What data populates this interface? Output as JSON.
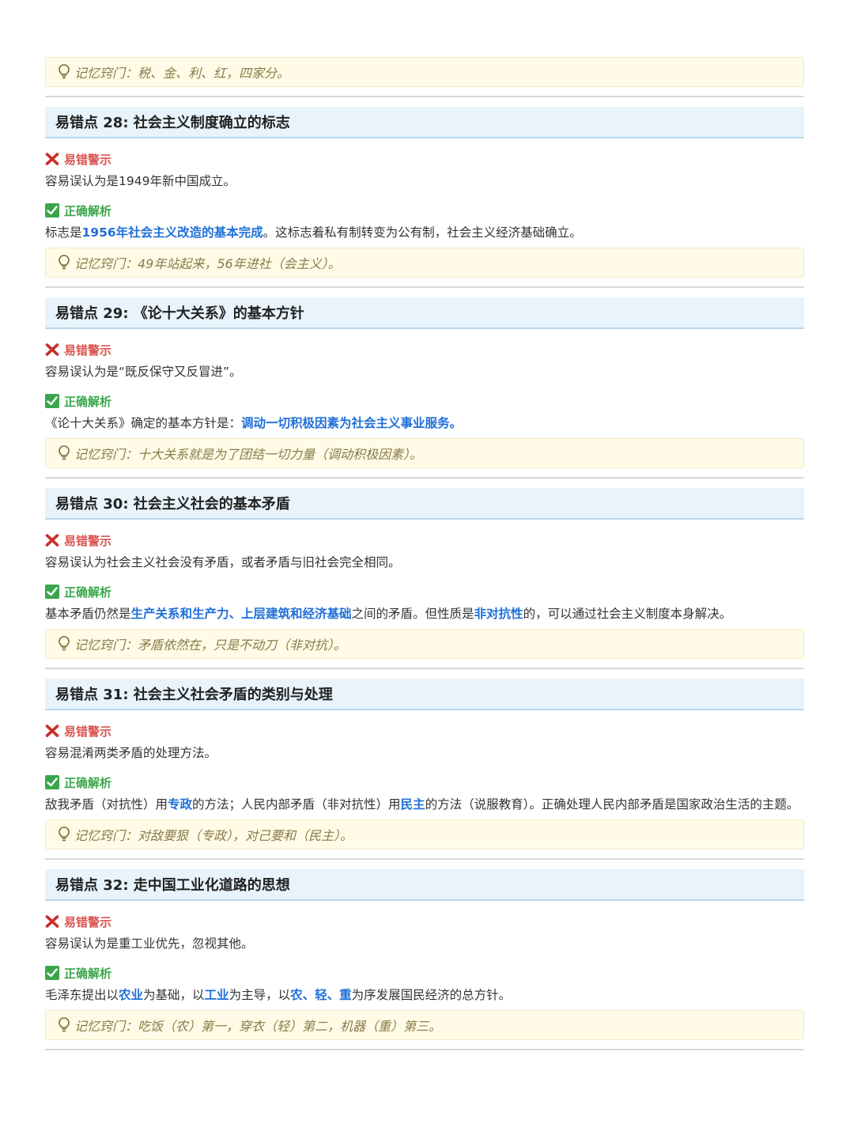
{
  "tips": {
    "t27": "记忆窍门：税、金、利、红，四家分。",
    "t28": "记忆窍门：49年站起来，56年进社（会主义）。",
    "t29": "记忆窍门：十大关系就是为了团结一切力量（调动积极因素）。",
    "t30": "记忆窍门：矛盾依然在，只是不动刀（非对抗）。",
    "t31": "记忆窍门：对敌要狠（专政），对己要和（民主）。",
    "t32": "记忆窍门：吃饭（农）第一，穿衣（轻）第二，机器（重）第三。"
  },
  "labels": {
    "wrong": "易错警示",
    "right": "正确解析"
  },
  "sections": [
    {
      "title": "易错点 28: 社会主义制度确立的标志",
      "wrong": "容易误认为是1949年新中国成立。",
      "right": [
        "标志是",
        "1956年社会主义改造的基本完成",
        "。这标志着私有制转变为公有制，社会主义经济基础确立。"
      ]
    },
    {
      "title": "易错点 29: 《论十大关系》的基本方针",
      "wrong": "容易误认为是“既反保守又反冒进”。",
      "right": [
        "《论十大关系》确定的基本方针是：",
        "调动一切积极因素为社会主义事业服务。"
      ]
    },
    {
      "title": "易错点 30: 社会主义社会的基本矛盾",
      "wrong": "容易误认为社会主义社会没有矛盾，或者矛盾与旧社会完全相同。",
      "right": [
        "基本矛盾仍然是",
        "生产关系和生产力、上层建筑和经济基础",
        "之间的矛盾。但性质是",
        "非对抗性",
        "的，可以通过社会主义制度本身解决。"
      ]
    },
    {
      "title": "易错点 31: 社会主义社会矛盾的类别与处理",
      "wrong": "容易混淆两类矛盾的处理方法。",
      "right": [
        "敌我矛盾（对抗性）用",
        "专政",
        "的方法；人民内部矛盾（非对抗性）用",
        "民主",
        "的方法（说服教育）。正确处理人民内部矛盾是国家政治生活的主题。"
      ]
    },
    {
      "title": "易错点 32: 走中国工业化道路的思想",
      "wrong": "容易误认为是重工业优先，忽视其他。",
      "right": [
        "毛泽东提出以",
        "农业",
        "为基础，以",
        "工业",
        "为主导，以",
        "农、轻、重",
        "为序发展国民经济的总方针。"
      ]
    }
  ],
  "colors": {
    "highlight": "#1e6fd9",
    "wrong": "#d9534f",
    "right": "#3aa64b",
    "tip_bg": "#fffbe6",
    "head_bg": "#e8f3fb"
  },
  "icons": {
    "tip": "lightbulb-icon",
    "wrong": "cross-icon",
    "right": "checkbox-check-icon"
  }
}
